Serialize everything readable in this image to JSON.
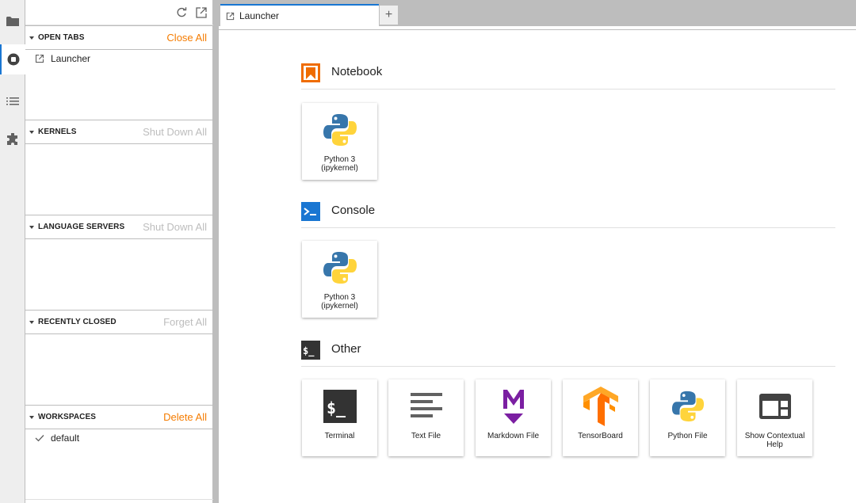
{
  "activity_bar": {
    "items": [
      {
        "icon": "folder-icon"
      },
      {
        "icon": "running-icon"
      },
      {
        "icon": "table-of-contents-icon"
      },
      {
        "icon": "extension-icon"
      }
    ]
  },
  "sidebar": {
    "sections": [
      {
        "title": "OPEN TABS",
        "action": "Close All",
        "action_enabled": true,
        "items": [
          {
            "label": "Launcher",
            "icon": "launcher-icon"
          }
        ]
      },
      {
        "title": "KERNELS",
        "action": "Shut Down All",
        "action_enabled": false,
        "items": []
      },
      {
        "title": "LANGUAGE SERVERS",
        "action": "Shut Down All",
        "action_enabled": false,
        "items": []
      },
      {
        "title": "RECENTLY CLOSED",
        "action": "Forget All",
        "action_enabled": false,
        "items": []
      },
      {
        "title": "WORKSPACES",
        "action": "Delete All",
        "action_enabled": true,
        "items": [
          {
            "label": "default",
            "icon": "check-icon"
          }
        ]
      }
    ]
  },
  "tabs": [
    {
      "label": "Launcher",
      "active": true
    }
  ],
  "new_tab_label": "+",
  "launcher": {
    "categories": [
      {
        "title": "Notebook",
        "icon": "notebook-icon",
        "cards": [
          {
            "label_line1": "Python 3",
            "label_line2": "(ipykernel)",
            "icon": "python-icon"
          }
        ]
      },
      {
        "title": "Console",
        "icon": "console-icon",
        "cards": [
          {
            "label_line1": "Python 3",
            "label_line2": "(ipykernel)",
            "icon": "python-icon"
          }
        ]
      },
      {
        "title": "Other",
        "icon": "other-terminal-icon",
        "cards": [
          {
            "label_line1": "Terminal",
            "label_line2": "",
            "icon": "terminal-icon"
          },
          {
            "label_line1": "Text File",
            "label_line2": "",
            "icon": "text-file-icon"
          },
          {
            "label_line1": "Markdown File",
            "label_line2": "",
            "icon": "markdown-icon"
          },
          {
            "label_line1": "TensorBoard",
            "label_line2": "",
            "icon": "tensorboard-icon"
          },
          {
            "label_line1": "Python File",
            "label_line2": "",
            "icon": "python-icon"
          },
          {
            "label_line1": "Show Contextual",
            "label_line2": "Help",
            "icon": "contextual-help-icon"
          }
        ]
      }
    ]
  },
  "colors": {
    "accent_blue": "#1976d2",
    "accent_orange": "#f57c00",
    "disabled_text": "#bdbdbd"
  }
}
